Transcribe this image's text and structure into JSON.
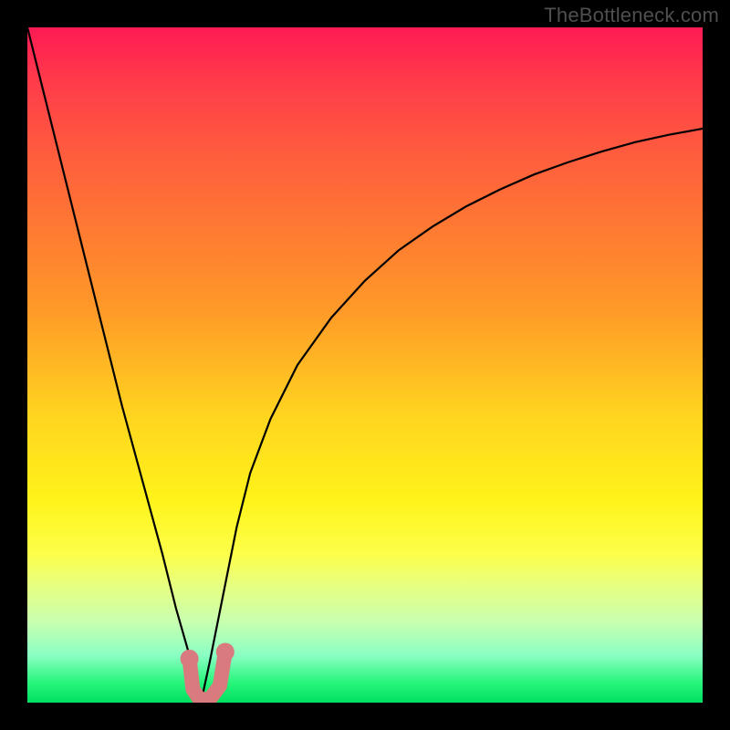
{
  "watermark": "TheBottleneck.com",
  "colors": {
    "background": "#000000",
    "gradient_top": "#ff1a54",
    "gradient_mid": "#fff31a",
    "gradient_bottom": "#00e060",
    "curve": "#000000",
    "marker": "#d97b7e",
    "watermark_text": "#4f4f4f"
  },
  "chart_data": {
    "type": "line",
    "title": "",
    "xlabel": "",
    "ylabel": "",
    "xlim": [
      0,
      100
    ],
    "ylim": [
      0,
      100
    ],
    "grid": false,
    "legend": null,
    "annotations": [],
    "series": [
      {
        "name": "bottleneck-curve",
        "x": [
          0,
          2,
          5,
          8,
          11,
          14,
          17,
          20,
          22,
          24,
          25.7,
          27,
          29,
          31,
          33,
          36,
          40,
          45,
          50,
          55,
          60,
          65,
          70,
          75,
          80,
          85,
          90,
          95,
          100
        ],
        "y": [
          100,
          92,
          80,
          68,
          56,
          44,
          33,
          22,
          14,
          7,
          0,
          6,
          16,
          26,
          34,
          42,
          50,
          57,
          62.5,
          67,
          70.5,
          73.5,
          76,
          78.2,
          80,
          81.6,
          83,
          84.1,
          85
        ]
      }
    ],
    "marker": {
      "name": "highlight-segment",
      "x": [
        24.0,
        24.5,
        25.5,
        27.0,
        28.5,
        29.3
      ],
      "y": [
        6.5,
        2.0,
        0.5,
        0.5,
        2.5,
        7.5
      ]
    }
  }
}
